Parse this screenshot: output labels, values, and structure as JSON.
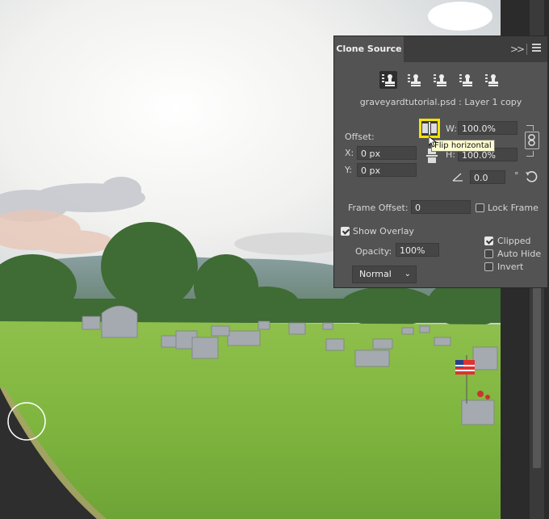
{
  "panel": {
    "tab_label": "Clone Source",
    "collapse_label": ">>",
    "source_buttons": [
      "clone-source-1",
      "clone-source-2",
      "clone-source-3",
      "clone-source-4",
      "clone-source-5"
    ],
    "source_name": "graveyardtutorial.psd : Layer 1 copy",
    "offset_label": "Offset:",
    "x_label": "X:",
    "x_value": "0 px",
    "y_label": "Y:",
    "y_value": "0 px",
    "w_label": "W:",
    "w_value": "100.0%",
    "h_label": "H:",
    "h_value": "100.0%",
    "angle_value": "0.0",
    "degree_symbol": "°",
    "tooltip": "Flip horizontal",
    "frame_offset_label": "Frame Offset:",
    "frame_offset_value": "0",
    "lock_frame_label": "Lock Frame",
    "show_overlay_label": "Show Overlay",
    "opacity_label": "Opacity:",
    "opacity_value": "100%",
    "blend_mode": "Normal",
    "clipped_label": "Clipped",
    "auto_hide_label": "Auto Hide",
    "invert_label": "Invert",
    "checks": {
      "lock_frame": false,
      "show_overlay": true,
      "clipped": true,
      "auto_hide": false,
      "invert": false
    }
  },
  "colors": {
    "panel_bg": "#535353",
    "tooltip_bg": "#fdfccf",
    "highlight": "#f5e400"
  }
}
